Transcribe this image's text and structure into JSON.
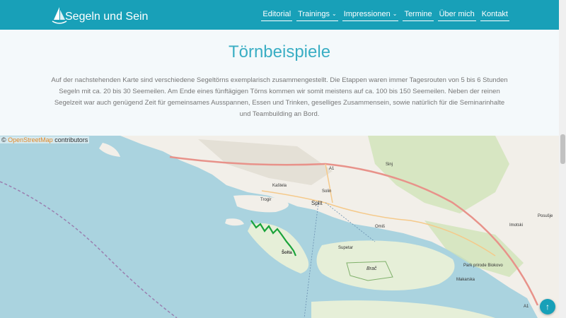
{
  "header": {
    "logo_text": "Segeln und Sein",
    "nav": [
      {
        "label": "Editorial",
        "dropdown": false
      },
      {
        "label": "Trainings",
        "dropdown": true
      },
      {
        "label": "Impressionen",
        "dropdown": true
      },
      {
        "label": "Termine",
        "dropdown": false
      },
      {
        "label": "Über mich",
        "dropdown": false
      },
      {
        "label": "Kontakt",
        "dropdown": false
      }
    ],
    "chevron": "⌄"
  },
  "main": {
    "title": "Törnbeispiele",
    "intro": "Auf der nachstehenden Karte sind verschiedene Segeltörns exemplarisch zusammengestellt. Die Etappen waren immer Tagesrouten von 5 bis 6 Stunden Segeln mit ca. 20 bis 30 Seemeilen. Am Ende eines fünftägigen Törns kommen wir somit meistens auf ca. 100 bis 150 Seemeilen. Neben der reinen Segelzeit war auch genügend Zeit für gemeinsames Ausspannen, Essen und Trinken, geselliges Zusammensein, sowie natürlich für die Seminarinhalte und Teambuilding an Bord."
  },
  "map": {
    "attribution_prefix": "©",
    "attribution_link": "OpenStreetMap",
    "attribution_suffix": " contributors",
    "labels": {
      "split": "Split",
      "solin": "Solin",
      "kastela": "Kaštela",
      "trogir": "Trogir",
      "brac": "Brač",
      "supetar": "Supetar",
      "solta": "Šolta",
      "omis": "Omiš",
      "makarska": "Makarska",
      "sinj": "Sinj",
      "imotski": "Imotski",
      "posusje": "Posušje",
      "park": "Park prirode Biokovo",
      "a1": "A1",
      "a1b": "A1"
    },
    "route_color": "#1aa33a",
    "land_color": "#f2efe9",
    "sea_color": "#aad3df"
  },
  "scroll_top_icon": "↑"
}
